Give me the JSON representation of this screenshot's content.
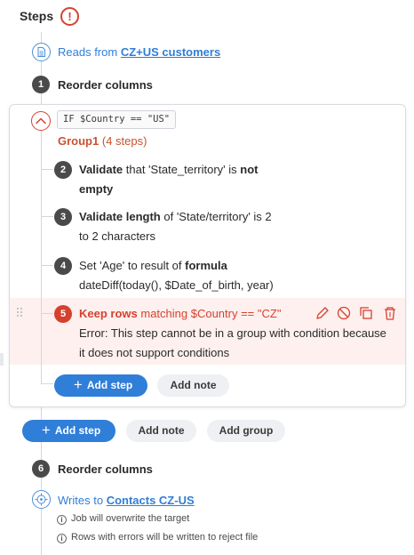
{
  "header": {
    "title": "Steps",
    "alert_icon": "!"
  },
  "source": {
    "prefix": "Reads from",
    "name": "CZ+US customers"
  },
  "steps": {
    "s1": {
      "num": "1",
      "label": "Reorder columns"
    },
    "s6": {
      "num": "6",
      "label": "Reorder columns"
    }
  },
  "group": {
    "condition": "IF $Country == \"US\"",
    "name": "Group1",
    "count": "(4 steps)",
    "s2": {
      "num": "2",
      "bold": "Validate",
      "text1": " that 'State_territory' is ",
      "bold2": "not",
      "line2": "empty"
    },
    "s3": {
      "num": "3",
      "bold": "Validate length",
      "text1": " of 'State/territory' is 2",
      "line2": "to 2 characters"
    },
    "s4": {
      "num": "4",
      "text1": "Set 'Age' to result of ",
      "bold": "formula",
      "line2": "dateDiff(today(), $Date_of_birth, year)"
    },
    "s5": {
      "num": "5",
      "bold": "Keep rows",
      "cond": " matching $Country == \"CZ\"",
      "error1": "Error: This step cannot be in a group with condition because",
      "error2": "it does not support conditions"
    },
    "add_step": "Add step",
    "add_note": "Add note"
  },
  "toolbar": {
    "add_step": "Add step",
    "add_note": "Add note",
    "add_group": "Add group"
  },
  "target": {
    "prefix": "Writes to",
    "name": "Contacts CZ-US",
    "note1": "Job will overwrite the target",
    "note2": "Rows with errors will be written to reject file"
  },
  "colors": {
    "accent": "#2f7ed8",
    "error": "#d6412f",
    "group": "#c8532f",
    "badge": "#4a4a4a"
  }
}
